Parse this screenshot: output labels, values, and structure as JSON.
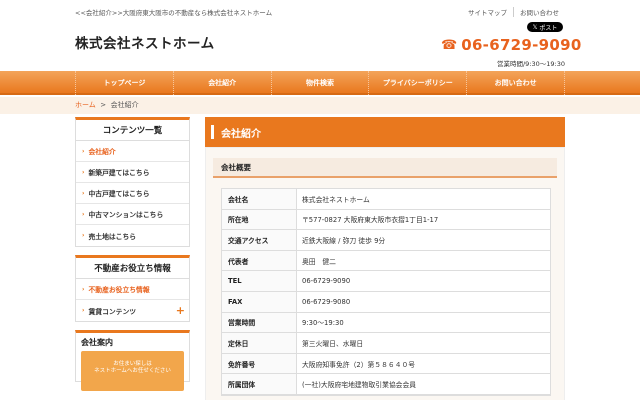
{
  "header": {
    "tagline": "<<会社紹介>>大阪府東大阪市の不動産なら株式会社ネストホーム",
    "top_links": [
      "サイトマップ",
      "お問い合わせ"
    ],
    "x_post_label": "ポスト",
    "company_name": "株式会社ネストホーム",
    "phone": "06-6729-9090",
    "hours": "営業時間/9:30〜19:30"
  },
  "nav": [
    "トップページ",
    "会社紹介",
    "物件検索",
    "プライバシーポリシー",
    "お問い合わせ"
  ],
  "breadcrumb": {
    "home": "ホーム",
    "sep": ">",
    "current": "会社紹介"
  },
  "sidebar": {
    "contents_title": "コンテンツ一覧",
    "contents_items": [
      "会社紹介",
      "新築戸建てはこちら",
      "中古戸建てはこちら",
      "中古マンションはこちら",
      "売土地はこちら"
    ],
    "info_title": "不動産お役立ち情報",
    "info_items": [
      "不動産お役立ち情報",
      "賃貸コンテンツ"
    ],
    "guide_title": "会社案内",
    "guide_text": "お住まい探しは\nネストホームへお任せください"
  },
  "main": {
    "heading": "会社紹介",
    "section_title": "会社概要",
    "rows": [
      {
        "label": "会社名",
        "value": "株式会社ネストホーム"
      },
      {
        "label": "所在地",
        "value": "〒577-0827 大阪府東大阪市衣摺1丁目1-17"
      },
      {
        "label": "交通アクセス",
        "value": "近鉄大阪線 / 弥刀 徒歩 9分"
      },
      {
        "label": "代表者",
        "value": "奥田　健二"
      },
      {
        "label": "TEL",
        "value": "06-6729-9090"
      },
      {
        "label": "FAX",
        "value": "06-6729-9080"
      },
      {
        "label": "営業時間",
        "value": "9:30〜19:30"
      },
      {
        "label": "定休日",
        "value": "第三火曜日、水曜日"
      },
      {
        "label": "免許番号",
        "value": "大阪府知事免許（2）第５８６４０号"
      },
      {
        "label": "所属団体",
        "value": "(一社)大阪府宅地建物取引業協会会員"
      }
    ]
  },
  "colors": {
    "accent": "#e9781e",
    "phone": "#e8621e"
  }
}
